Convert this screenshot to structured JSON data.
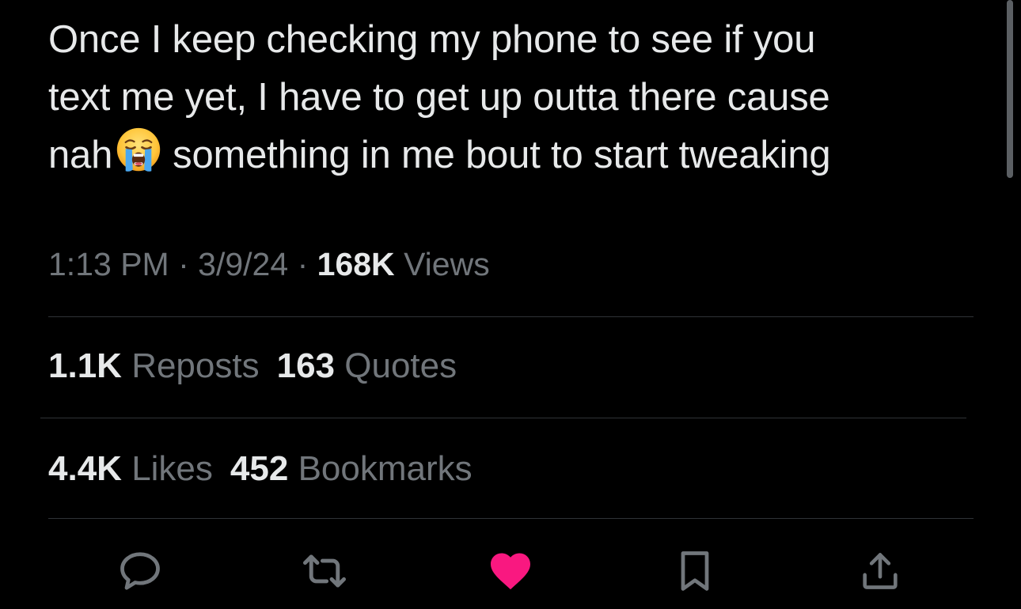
{
  "tweet": {
    "line1": "Once I keep checking my phone to see if you",
    "line2": "text me yet, I have to get up outta there cause",
    "line3_before": "nah",
    "line3_emoji": "loudly-crying-face",
    "line3_after": "something in me bout to start tweaking"
  },
  "meta": {
    "time": "1:13 PM",
    "sep1": "·",
    "date": "3/9/24",
    "sep2": "·",
    "views_count": "168K",
    "views_label": "Views"
  },
  "stats": {
    "reposts_count": "1.1K",
    "reposts_label": "Reposts",
    "quotes_count": "163",
    "quotes_label": "Quotes",
    "likes_count": "4.4K",
    "likes_label": "Likes",
    "bookmarks_count": "452",
    "bookmarks_label": "Bookmarks"
  },
  "actions": {
    "icons": [
      "reply-icon",
      "repost-icon",
      "like-icon",
      "bookmark-icon",
      "share-icon"
    ],
    "liked": true
  },
  "colors": {
    "background": "#000000",
    "text_primary": "#e7e9ea",
    "text_secondary": "#71767b",
    "divider": "#2f3336",
    "like_active": "#f91880"
  }
}
